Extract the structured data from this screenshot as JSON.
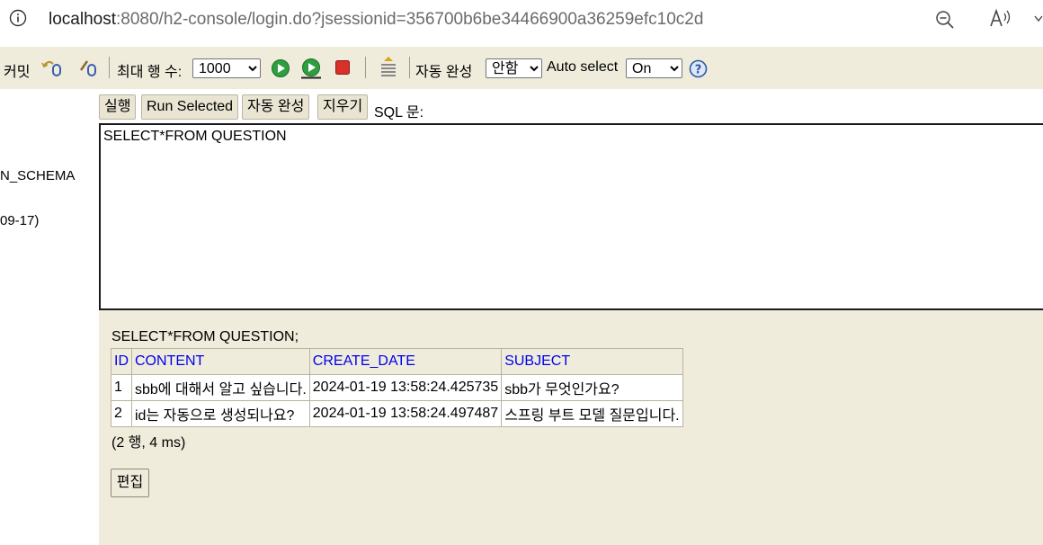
{
  "addressbar": {
    "url_host": "localhost",
    "url_rest": ":8080/h2-console/login.do?jsessionid=356700b6be34466900a36259efc10c2d",
    "icons": [
      "info-icon",
      "zoom-out-icon",
      "read-aloud-icon",
      "more-icon"
    ]
  },
  "toolbar": {
    "commit_label": "커밋",
    "max_rows_label": "최대 행 수:",
    "max_rows_value": "1000",
    "autocomplete_label": "자동 완성",
    "autocomplete_value": "안함",
    "autoselect_label": "Auto select",
    "autoselect_value": "On"
  },
  "left_panel": {
    "items": [
      "N_SCHEMA",
      "09-17)"
    ]
  },
  "query_toolbar": {
    "run_label": "실행",
    "run_selected_label": "Run Selected",
    "autocomplete_label": "자동 완성",
    "clear_label": "지우기",
    "sql_label": "SQL 문:"
  },
  "editor": {
    "sql_text": "SELECT*FROM QUESTION"
  },
  "result": {
    "query": "SELECT*FROM QUESTION;",
    "columns": [
      "ID",
      "CONTENT",
      "CREATE_DATE",
      "SUBJECT"
    ],
    "rows": [
      [
        "1",
        "sbb에 대해서 알고 싶습니다.",
        "2024-01-19 13:58:24.425735",
        "sbb가 무엇인가요?"
      ],
      [
        "2",
        "id는 자동으로 생성되나요?",
        "2024-01-19 13:58:24.497487",
        "스프링 부트 모델 질문입니다."
      ]
    ],
    "count_text": "(2 행, 4 ms)",
    "edit_label": "편집"
  },
  "colors": {
    "panel_bg": "#efecdc",
    "header_link": "#0000ee",
    "run_green": "#2f9e3f",
    "stop_red": "#d9302c"
  }
}
